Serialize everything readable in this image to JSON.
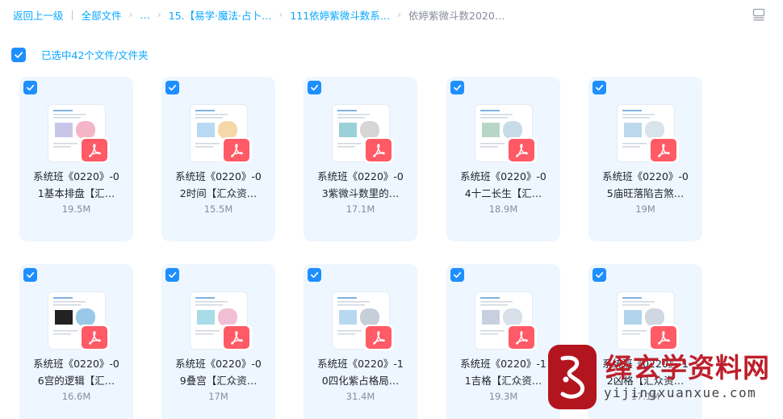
{
  "breadcrumb": {
    "back": "返回上一级",
    "all_files": "全部文件",
    "ellipsis": "…",
    "sep": "›",
    "folder1": "15.【易学·魔法·占卜…",
    "folder2": "111依婷紫微斗数系…",
    "current": "依婷紫微斗数2020…"
  },
  "selection": {
    "text": "已选中42个文件/文件夹"
  },
  "files": [
    {
      "line1": "系统班《0220》-0",
      "line2": "1基本排盘【汇…",
      "size": "19.5M"
    },
    {
      "line1": "系统班《0220》-0",
      "line2": "2时间【汇众资…",
      "size": "15.5M"
    },
    {
      "line1": "系统班《0220》-0",
      "line2": "3紫微斗数里的…",
      "size": "17.1M"
    },
    {
      "line1": "系统班《0220》-0",
      "line2": "4十二长生【汇…",
      "size": "18.9M"
    },
    {
      "line1": "系统班《0220》-0",
      "line2": "5庙旺落陷吉煞…",
      "size": "19M"
    },
    {
      "line1": "系统班《0220》-0",
      "line2": "6宫的逻辑【汇…",
      "size": "16.6M"
    },
    {
      "line1": "系统班《0220》-0",
      "line2": "9叠宫【汇众资…",
      "size": "17M"
    },
    {
      "line1": "系统班《0220》-1",
      "line2": "0四化紫占格局…",
      "size": "31.4M"
    },
    {
      "line1": "系统班《0220》-1",
      "line2": "1吉格【汇众资…",
      "size": "19.3M"
    },
    {
      "line1": "系统班《0220》-1",
      "line2": "2凶格【汇众资…",
      "size": "17.1M"
    }
  ],
  "watermark": {
    "title": "绎玄学资料网",
    "domain": "yijingxuanxue.com"
  },
  "colors": {
    "accent": "#06a7ff",
    "checkbox": "#1e8fff",
    "card_bg": "#eef6ff",
    "pdf_red": "#ff5a66",
    "watermark_red": "#bd1f2a"
  },
  "icons": {
    "checkbox": "check-icon",
    "file_type": "pdf-icon",
    "view_toggle": "list-view-icon"
  }
}
